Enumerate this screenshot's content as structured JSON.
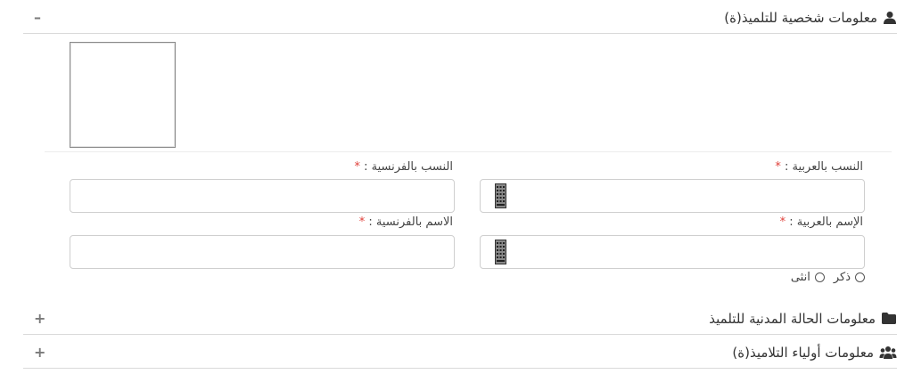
{
  "sections": {
    "personal": {
      "title": "معلومات شخصية للتلميذ(ة)",
      "toggle": "–",
      "icon": "user-icon"
    },
    "civil": {
      "title": "معلومات الحالة المدنية للتلميذ",
      "toggle": "+",
      "icon": "folder-icon"
    },
    "guardians": {
      "title": "معلومات أولياء التلاميذ(ة)",
      "toggle": "+",
      "icon": "users-icon"
    }
  },
  "form": {
    "lastname_ar": {
      "label": "النسب بالعربية :",
      "required": "*",
      "value": ""
    },
    "lastname_fr": {
      "label": "النسب بالفرنسية :",
      "required": "*",
      "value": ""
    },
    "firstname_ar": {
      "label": "الإسم بالعربية :",
      "required": "*",
      "value": ""
    },
    "firstname_fr": {
      "label": "الاسم بالفرنسية :",
      "required": "*",
      "value": ""
    },
    "gender": {
      "male": "ذكر",
      "female": "انثى"
    }
  },
  "colors": {
    "required": "#e0413b",
    "border": "#cfcfcf",
    "icon": "#333333"
  }
}
